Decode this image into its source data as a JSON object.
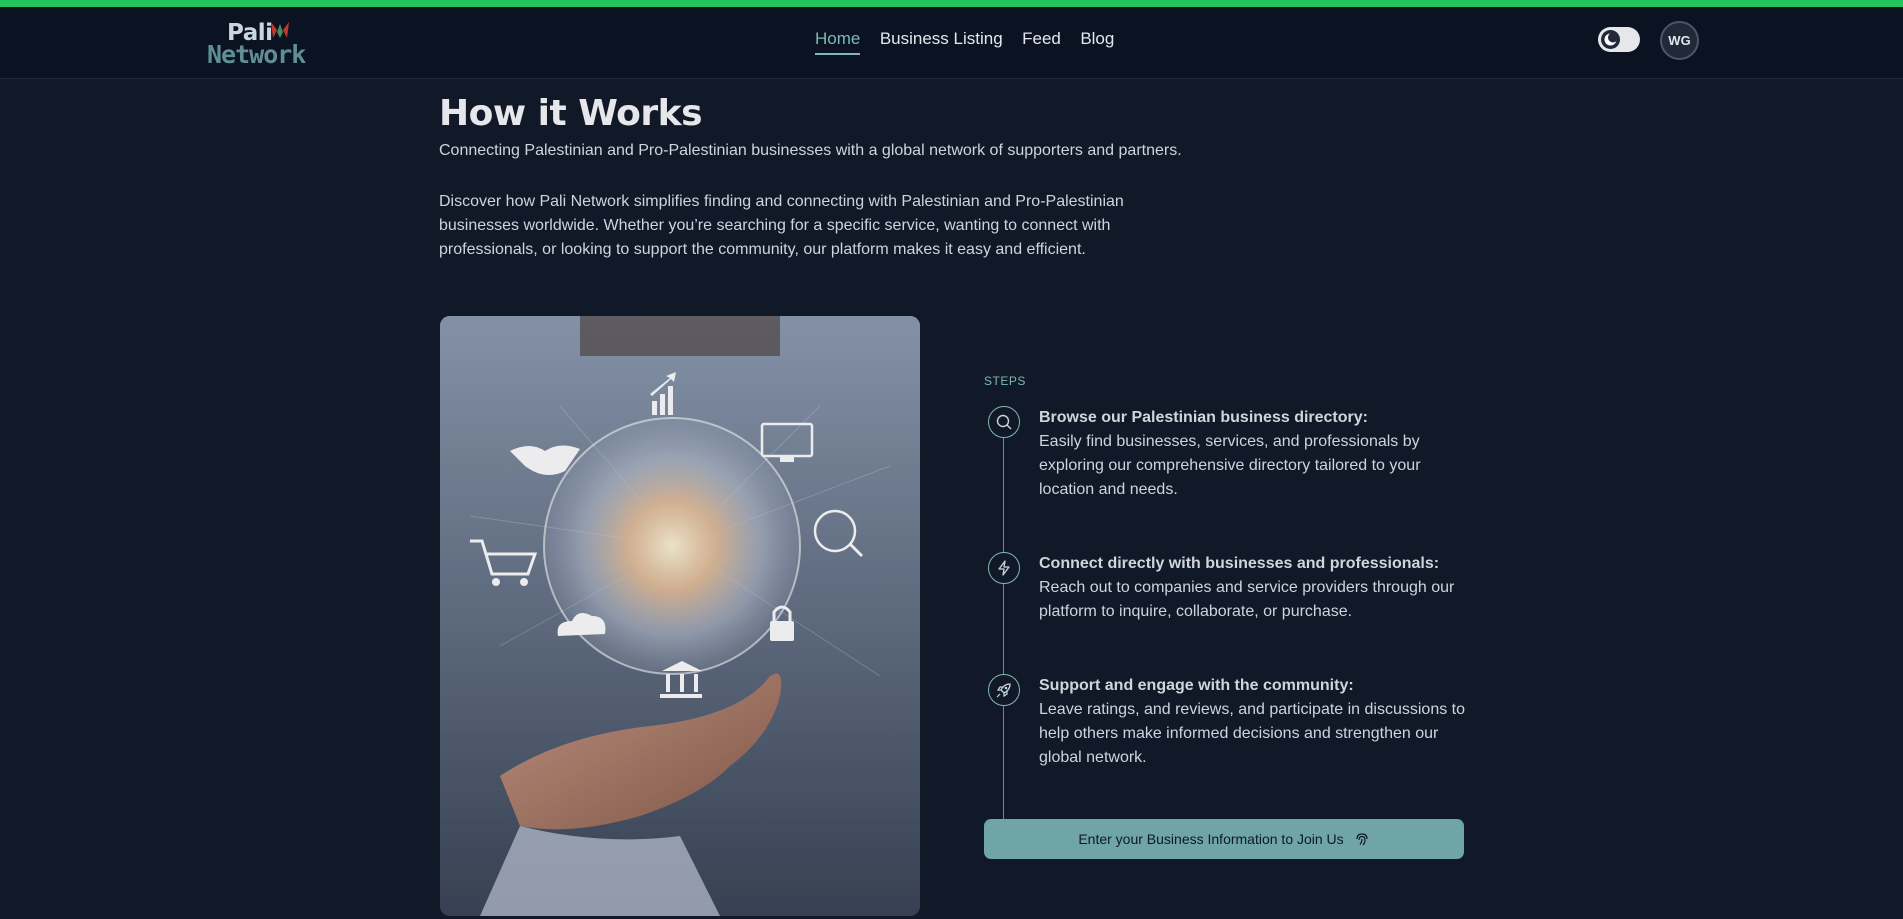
{
  "colors": {
    "accent_bar": "#22c55e",
    "brand_teal": "#7fb8b6",
    "button_bg": "#6fa5a5",
    "page_bg": "#111827",
    "header_bg": "#0b1222"
  },
  "brand": {
    "logo_line1": "Pali",
    "logo_line2": "Network"
  },
  "nav": {
    "links": [
      {
        "label": "Home",
        "active": true
      },
      {
        "label": "Business Listing",
        "active": false
      },
      {
        "label": "Feed",
        "active": false
      },
      {
        "label": "Blog",
        "active": false
      }
    ]
  },
  "header": {
    "theme_toggle_icon": "moon-icon",
    "avatar_initials": "WG"
  },
  "main": {
    "title": "How it Works",
    "subtitle": "Connecting Palestinian and Pro-Palestinian businesses with a global network of supporters and partners.",
    "description": "Discover how Pali Network simplifies finding and connecting with Palestinian and Pro-Palestinian businesses worldwide. Whether you’re searching for a specific service, wanting to connect with professionals, or looking to support the community, our platform makes it easy and efficient.",
    "steps_label": "STEPS",
    "steps": [
      {
        "icon": "search-icon",
        "title": "Browse our Palestinian business directory:",
        "body": "Easily find businesses, services, and professionals by exploring our comprehensive directory tailored to your location and needs."
      },
      {
        "icon": "lightning-icon",
        "title": "Connect directly with businesses and professionals:",
        "body": "Reach out to companies and service providers through our platform to inquire, collaborate, or purchase."
      },
      {
        "icon": "rocket-icon",
        "title": "Support and engage with the community:",
        "body": "Leave ratings, and reviews, and participate in discussions to help others make informed decisions and strengthen our global network."
      }
    ],
    "cta_label": "Enter your Business Information to Join Us",
    "cta_icon": "fingerprint-icon"
  }
}
